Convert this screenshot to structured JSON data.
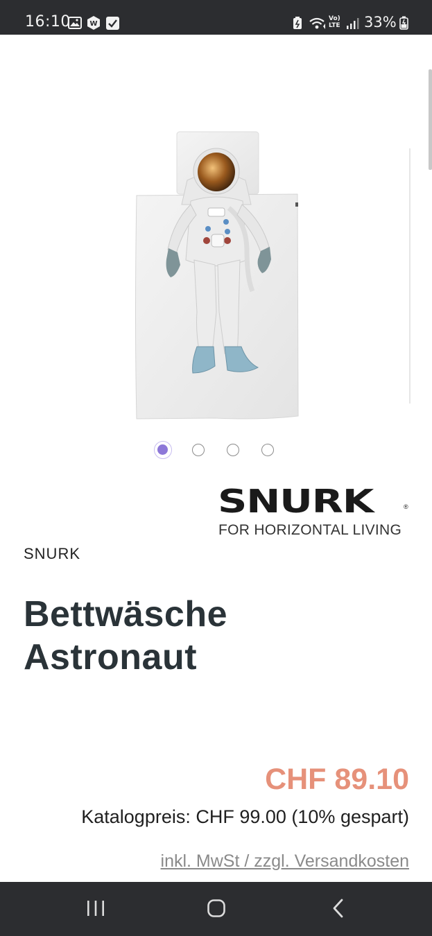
{
  "status_bar": {
    "time": "16:10",
    "battery": "33%",
    "left_icons": [
      "image-icon",
      "shield-app-icon",
      "checkbox-icon"
    ],
    "right_icons": [
      "nfc-battery-icon",
      "wifi-icon",
      "volte-icon",
      "signal-icon",
      "battery-icon"
    ],
    "volte_label_top": "Vo)",
    "volte_label_bottom": "LTE"
  },
  "gallery": {
    "image_alt": "Bettwäsche Astronaut product image",
    "dot_count": 4,
    "active_index": 0
  },
  "brand_logo": {
    "wordmark": "SNURK",
    "registered": "®",
    "tagline": "FOR HORIZONTAL LIVING"
  },
  "product": {
    "vendor": "SNURK",
    "title_line1": "Bettwäsche",
    "title_line2": "Astronaut",
    "price": "CHF 89.10",
    "catalog_price": "Katalogpreis: CHF 99.00 (10% gespart)",
    "tax_note": "inkl. MwSt / zzgl. Versandkosten"
  },
  "nav_bar": {
    "buttons": [
      "recent-apps-icon",
      "home-icon",
      "back-icon"
    ]
  },
  "colors": {
    "status_bar_bg": "#2c2d30",
    "accent_dot": "#8d78d8",
    "price": "#e6917a",
    "title": "#2a3338"
  }
}
